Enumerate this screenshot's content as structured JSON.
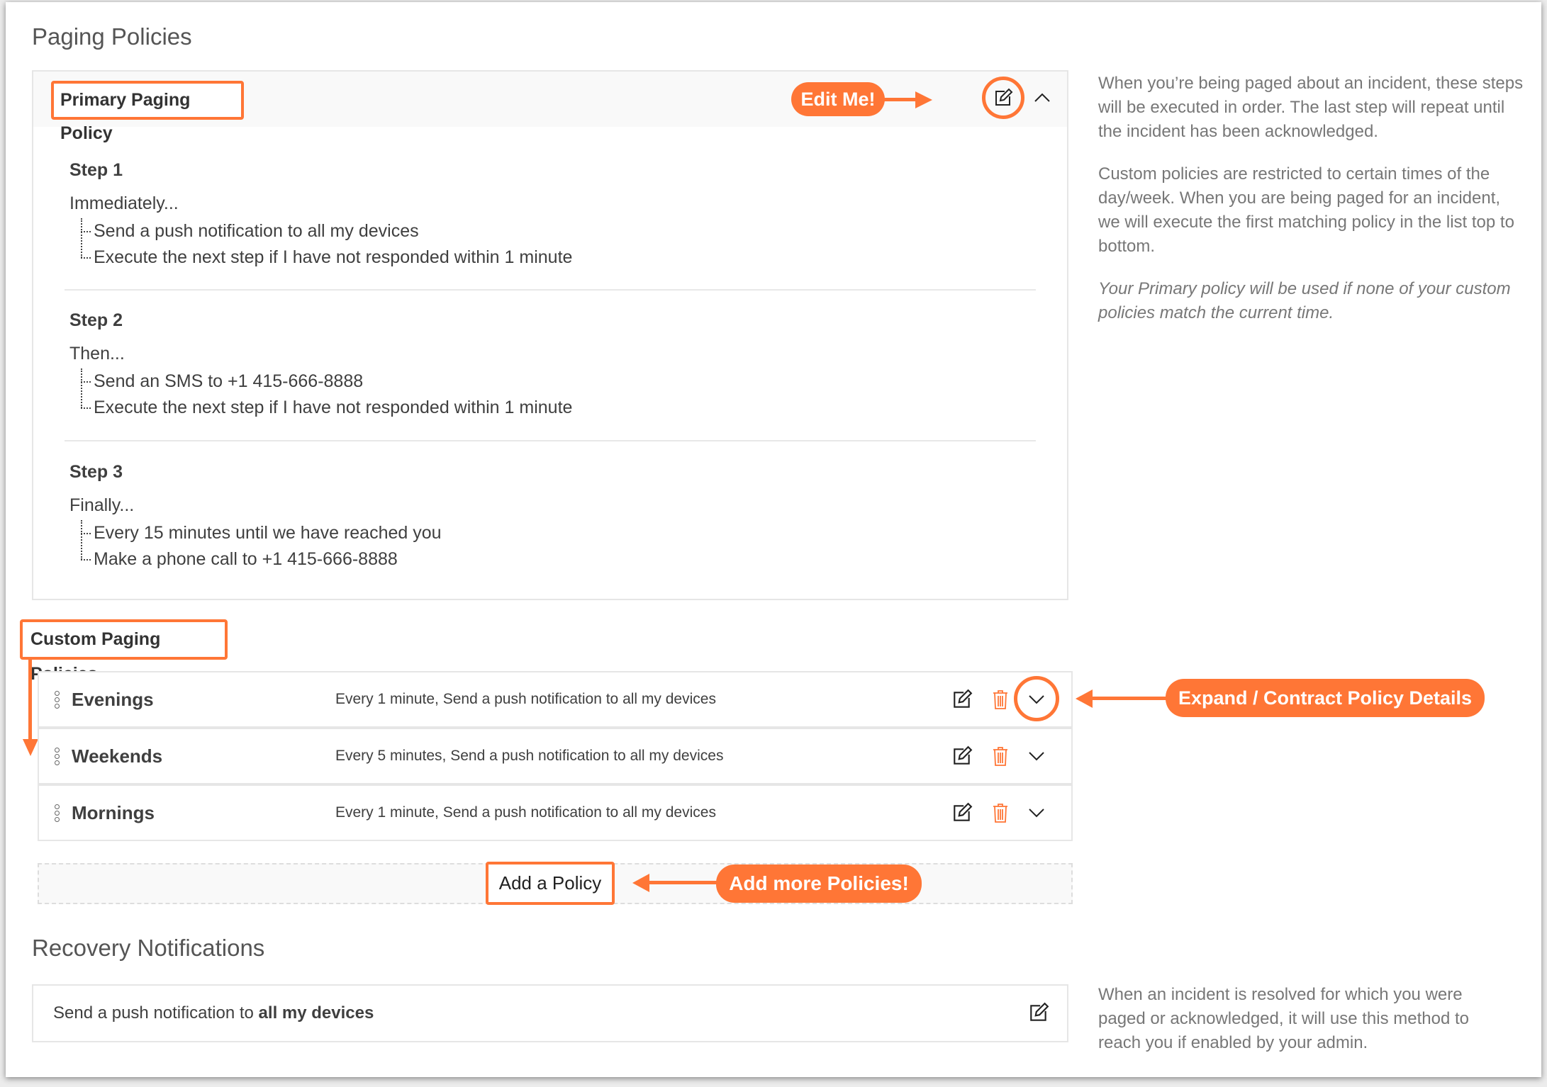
{
  "page": {
    "title": "Paging Policies"
  },
  "primary_policy": {
    "title": "Primary Paging Policy",
    "steps": [
      {
        "title": "Step 1",
        "lead": "Immediately...",
        "items": [
          "Send a push notification to all my devices",
          "Execute the next step if I have not responded within 1 minute"
        ]
      },
      {
        "title": "Step 2",
        "lead": "Then...",
        "items": [
          "Send an SMS to +1 415-666-8888",
          "Execute the next step if I have not responded within 1 minute"
        ]
      },
      {
        "title": "Step 3",
        "lead": "Finally...",
        "items": [
          "Every 15 minutes until we have reached you",
          "Make a phone call to +1 415-666-8888"
        ]
      }
    ]
  },
  "sidebar": {
    "p1": "When you’re being paged about an incident, these steps will be executed in order. The last step will repeat until the incident has been acknowledged.",
    "p2": "Custom policies are restricted to certain times of the day/week. When you are being paged for an incident, we will execute the first matching policy in the list top to bottom.",
    "p3": "Your Primary policy will be used if none of your custom policies match the current time.",
    "recovery": "When an incident is resolved for which you were paged or acknowledged, it will use this method to reach you if enabled by your admin."
  },
  "custom_policies": {
    "title": "Custom Paging Policies",
    "rows": [
      {
        "name": "Evenings",
        "description": "Every 1 minute, Send a push notification to all my devices"
      },
      {
        "name": "Weekends",
        "description": "Every 5 minutes, Send a push notification to all my devices"
      },
      {
        "name": "Mornings",
        "description": "Every 1 minute, Send a push notification to all my devices"
      }
    ],
    "add_label": "Add a Policy"
  },
  "recovery": {
    "title": "Recovery Notifications",
    "prefix": "Send a push notification to ",
    "target": "all my devices"
  },
  "annotations": {
    "edit_me": "Edit Me!",
    "expand": "Expand / Contract Policy Details",
    "add_more": "Add more Policies!"
  },
  "colors": {
    "accent": "#ff7636",
    "trash": "#ff7636",
    "text": "#3f3f3f",
    "muted": "#777777"
  }
}
